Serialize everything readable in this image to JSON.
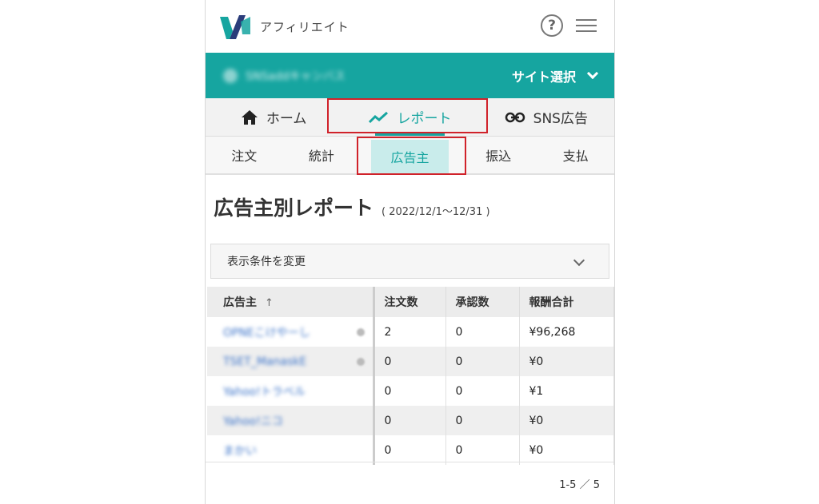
{
  "header": {
    "brand": "アフィリエイト",
    "logo_icon": "valuecommerce-logo-icon",
    "help_icon": "?",
    "menu_icon": "hamburger-menu-icon"
  },
  "site_bar": {
    "site_name": "SNSaddキャンバス",
    "select_label": "サイト選択"
  },
  "main_tabs": [
    {
      "label": "ホーム",
      "icon": "home-icon"
    },
    {
      "label": "レポート",
      "icon": "trend-icon"
    },
    {
      "label": "SNS広告",
      "icon": "link-icon"
    }
  ],
  "sub_tabs": [
    {
      "label": "注文"
    },
    {
      "label": "統計"
    },
    {
      "label": "広告主"
    },
    {
      "label": "振込"
    },
    {
      "label": "支払"
    }
  ],
  "page": {
    "title": "広告主別レポート",
    "period": "( 2022/12/1～12/31 )"
  },
  "filter": {
    "label": "表示条件を変更"
  },
  "table": {
    "headers": [
      "広告主",
      "注文数",
      "承認数",
      "報酬合計"
    ],
    "sort_arrow": "↑",
    "rows": [
      {
        "advertiser": "OPNEこけやーし",
        "orders": "2",
        "approved": "0",
        "reward": "¥96,268"
      },
      {
        "advertiser": "TSET_ManaskE",
        "orders": "0",
        "approved": "0",
        "reward": "¥0"
      },
      {
        "advertiser": "Yahoo!トラベル",
        "orders": "0",
        "approved": "0",
        "reward": "¥1"
      },
      {
        "advertiser": "Yahoo!ニコ",
        "orders": "0",
        "approved": "0",
        "reward": "¥0"
      },
      {
        "advertiser": "まかい",
        "orders": "0",
        "approved": "0",
        "reward": "¥0"
      }
    ]
  },
  "pager": {
    "text": "1-5 ／ 5"
  },
  "colors": {
    "accent": "#16a5a0",
    "highlight": "#d0222a",
    "link": "#3b73c9"
  }
}
